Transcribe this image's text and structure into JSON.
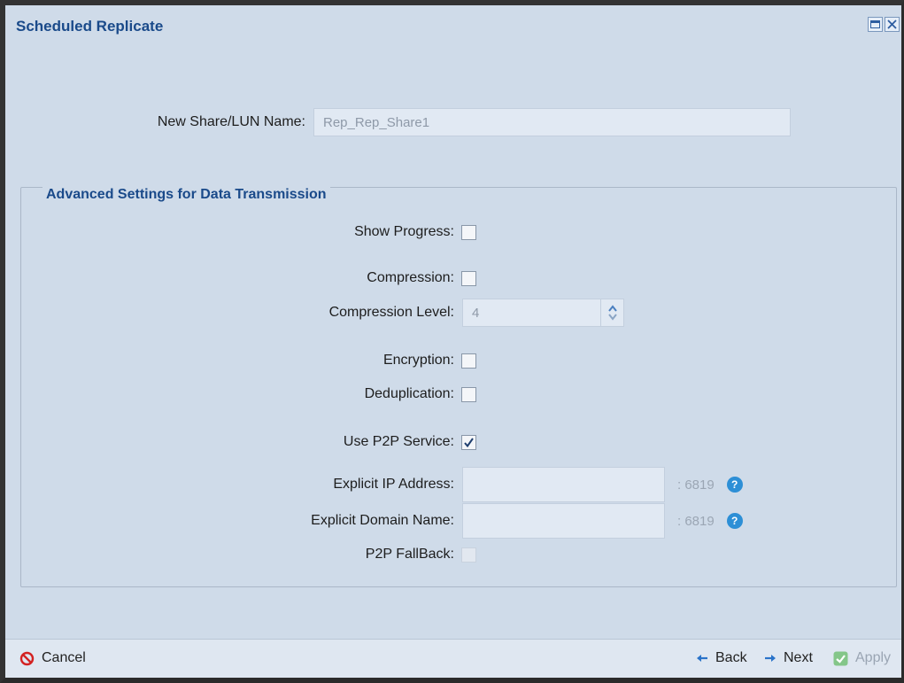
{
  "window": {
    "title": "Scheduled Replicate",
    "maximize_icon": "maximize-icon",
    "close_icon": "close-icon"
  },
  "share": {
    "label": "New Share/LUN Name:",
    "value": "Rep_Rep_Share1"
  },
  "advanced": {
    "legend": "Advanced Settings for Data Transmission",
    "show_progress": {
      "label": "Show Progress:",
      "checked": false
    },
    "compression": {
      "label": "Compression:",
      "checked": false
    },
    "compression_level": {
      "label": "Compression Level:",
      "value": "4"
    },
    "encryption": {
      "label": "Encryption:",
      "checked": false
    },
    "deduplication": {
      "label": "Deduplication:",
      "checked": false
    },
    "use_p2p": {
      "label": "Use P2P Service:",
      "checked": true
    },
    "explicit_ip": {
      "label": "Explicit IP Address:",
      "value": "",
      "port": ": 6819"
    },
    "explicit_domain": {
      "label": "Explicit Domain Name:",
      "value": "",
      "port": ": 6819"
    },
    "p2p_fallback": {
      "label": "P2P FallBack:",
      "checked": false,
      "disabled": true
    }
  },
  "footer": {
    "cancel": "Cancel",
    "back": "Back",
    "next": "Next",
    "apply": "Apply"
  },
  "colors": {
    "background": "#cfdbe9",
    "title": "#1a4a8a",
    "help": "#2d8fd6",
    "cancel_icon": "#d32222",
    "apply_icon": "#4caf50"
  }
}
